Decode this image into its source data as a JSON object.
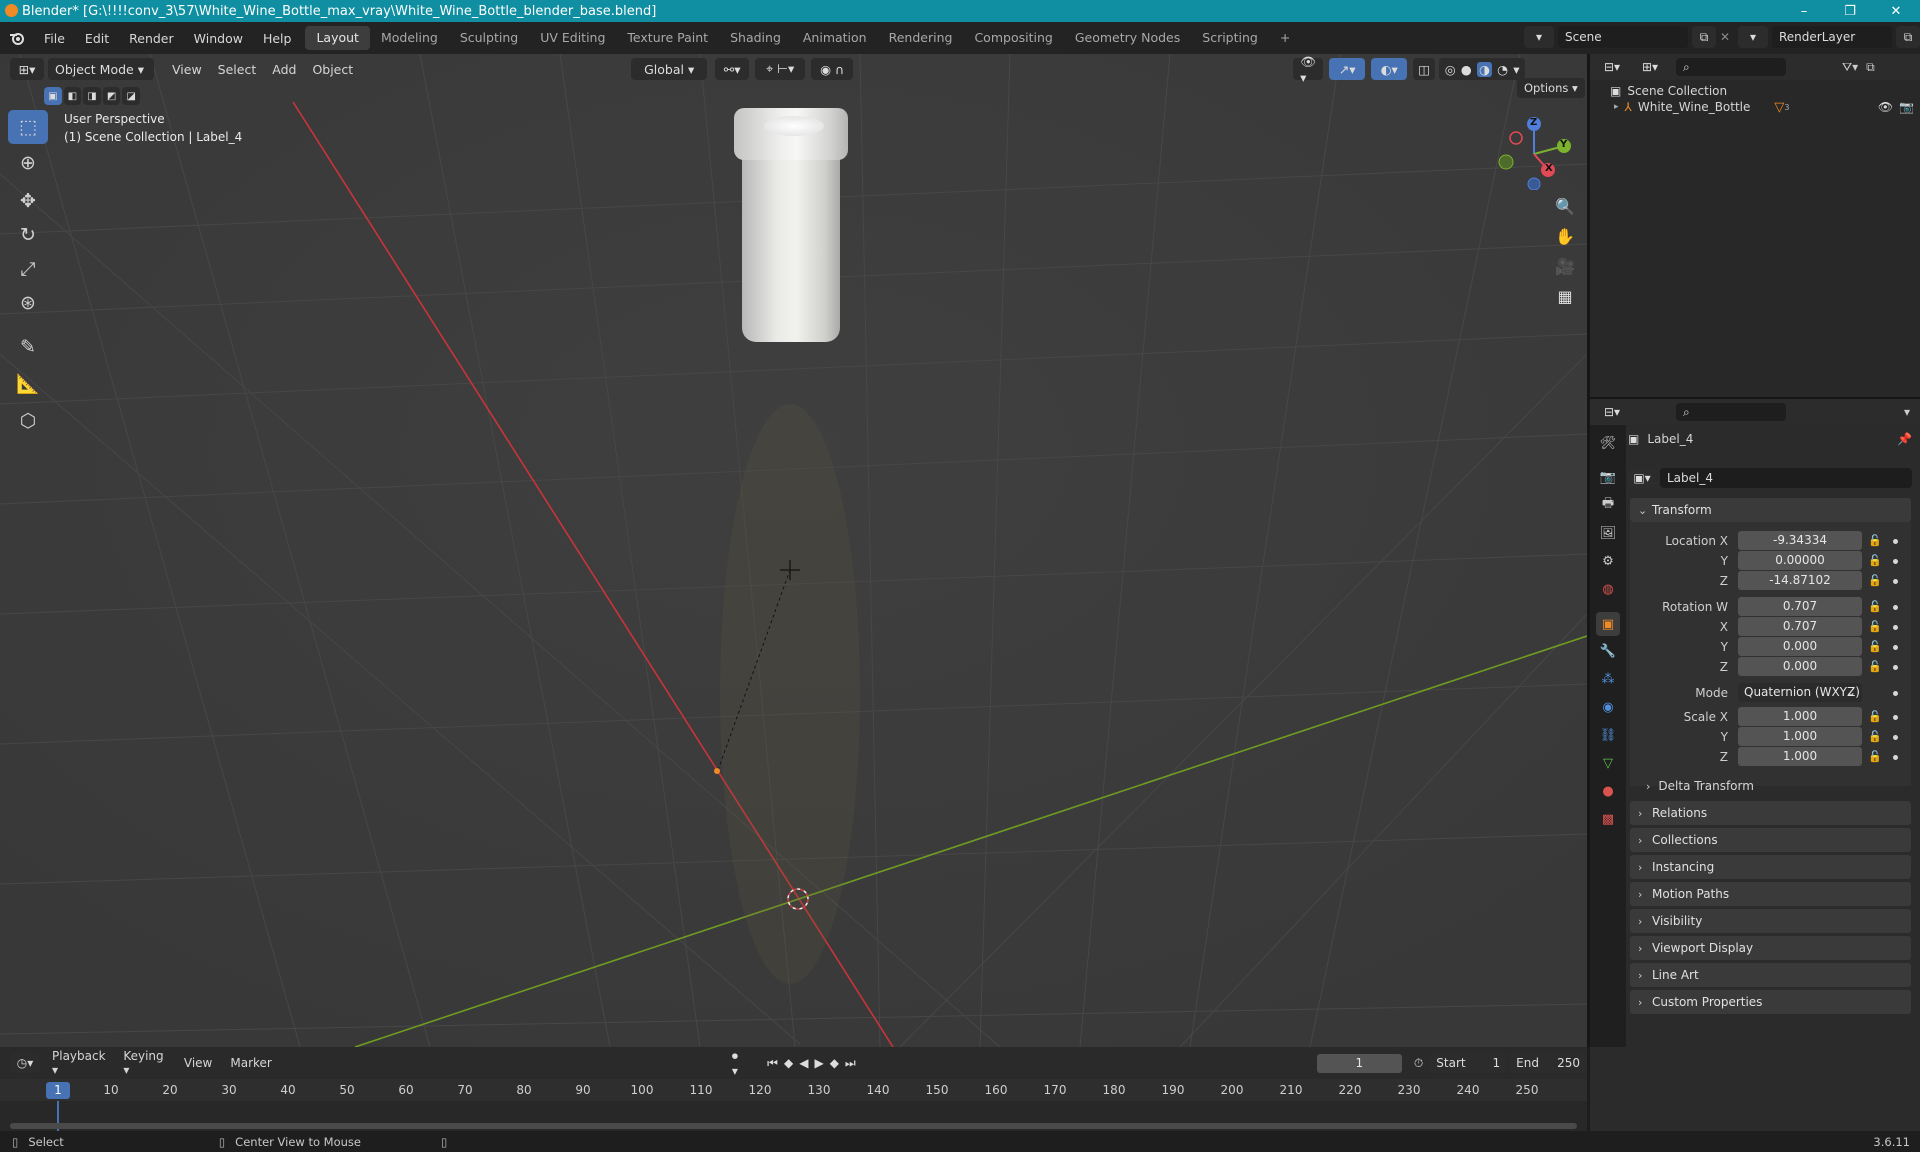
{
  "titlebar": {
    "title": "Blender* [G:\\!!!!conv_3\\57\\White_Wine_Bottle_max_vray\\White_Wine_Bottle_blender_base.blend]",
    "minimize": "–",
    "maximize": "❐",
    "close": "✕"
  },
  "menu": [
    "File",
    "Edit",
    "Render",
    "Window",
    "Help"
  ],
  "workspaces": [
    "Layout",
    "Modeling",
    "Sculpting",
    "UV Editing",
    "Texture Paint",
    "Shading",
    "Animation",
    "Rendering",
    "Compositing",
    "Geometry Nodes",
    "Scripting",
    "+"
  ],
  "scene": {
    "name": "Scene",
    "render_layer": "RenderLayer"
  },
  "viewport": {
    "mode": "Object Mode",
    "menus": [
      "View",
      "Select",
      "Add",
      "Object"
    ],
    "orientation": "Global",
    "options_label": "Options",
    "info_line1": "User Perspective",
    "info_line2": "(1) Scene Collection | Label_4",
    "gizmo": {
      "z": "Z",
      "y": "Y",
      "x": "X"
    }
  },
  "outliner": {
    "root": "Scene Collection",
    "items": [
      {
        "name": "White_Wine_Bottle",
        "badge": "3"
      }
    ]
  },
  "properties": {
    "header_object": "Label_4",
    "object_name": "Label_4",
    "transform_title": "Transform",
    "location_label": "Location X",
    "location": {
      "x": "-9.34334",
      "y": "0.00000",
      "z": "-14.87102"
    },
    "rotation_label": "Rotation W",
    "rotation": {
      "w": "0.707",
      "x": "0.707",
      "y": "0.000",
      "z": "0.000"
    },
    "mode_label": "Mode",
    "mode_value": "Quaternion (WXYZ)",
    "scale_label": "Scale X",
    "scale": {
      "x": "1.000",
      "y": "1.000",
      "z": "1.000"
    },
    "axis_y": "Y",
    "axis_z": "Z",
    "axis_x": "X",
    "delta": "Delta Transform",
    "panels": [
      "Relations",
      "Collections",
      "Instancing",
      "Motion Paths",
      "Visibility",
      "Viewport Display",
      "Line Art",
      "Custom Properties"
    ]
  },
  "timeline": {
    "menus": [
      "Playback",
      "Keying",
      "View",
      "Marker"
    ],
    "current_frame": "1",
    "start_label": "Start",
    "start": "1",
    "end_label": "End",
    "end": "250",
    "ticks": [
      "1",
      "10",
      "20",
      "30",
      "40",
      "50",
      "60",
      "70",
      "80",
      "90",
      "100",
      "110",
      "120",
      "130",
      "140",
      "150",
      "160",
      "170",
      "180",
      "190",
      "200",
      "210",
      "220",
      "230",
      "240",
      "250"
    ]
  },
  "status": {
    "select": "Select",
    "center": "Center View to Mouse",
    "version": "3.6.11"
  }
}
